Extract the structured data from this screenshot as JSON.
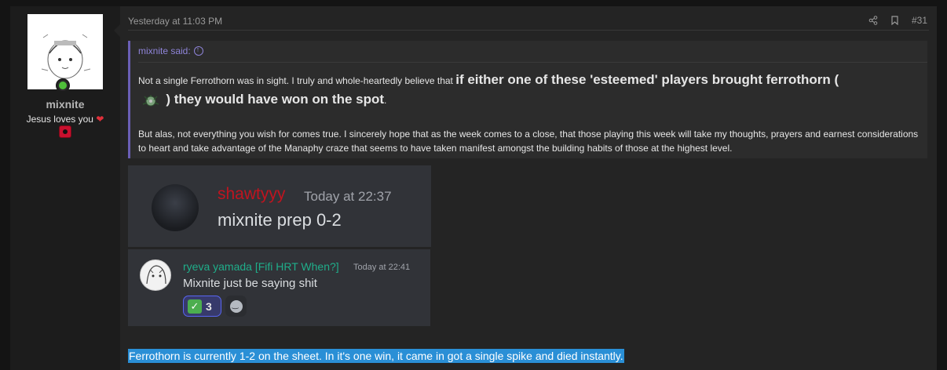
{
  "user": {
    "username": "mixnite",
    "title": "Jesus loves you",
    "heart": "❤"
  },
  "post": {
    "date": "Yesterday at 11:03 PM",
    "number": "#31"
  },
  "quote": {
    "author": "mixnite said:",
    "text_part1": "Not a single Ferrothorn was in sight. I truly and whole-heartedly believe that ",
    "bold_part1": "if either one of these 'esteemed' players brought ferrothorn (",
    "bold_part2": ") they would have won on the spot",
    "text_end": ".",
    "paragraph2": "But alas, not everything you wish for comes true. I sincerely hope that as the week comes to a close, that those playing this week will take my thoughts, prayers and earnest considerations to heart and take advantage of the Manaphy craze that seems to have taken manifest amongst the building habits of those at the highest level."
  },
  "discord1": {
    "name": "shawtyyy",
    "time": "Today at 22:37",
    "message": "mixnite prep 0-2"
  },
  "discord2": {
    "name": "ryeva yamada [Fifi HRT When?]",
    "time": "Today at 22:41",
    "message": "Mixnite just be saying shit",
    "reaction_emoji": "✓",
    "reaction_count": "3"
  },
  "footer_text": "Ferrothorn is currently 1-2 on the sheet. In it's one win, it came in got a single spike and died instantly.",
  "colors": {
    "accent": "#6a5fb5",
    "discord_name1": "#c0141f",
    "discord_name2": "#1fae8a",
    "selection": "#2a8fd6"
  }
}
